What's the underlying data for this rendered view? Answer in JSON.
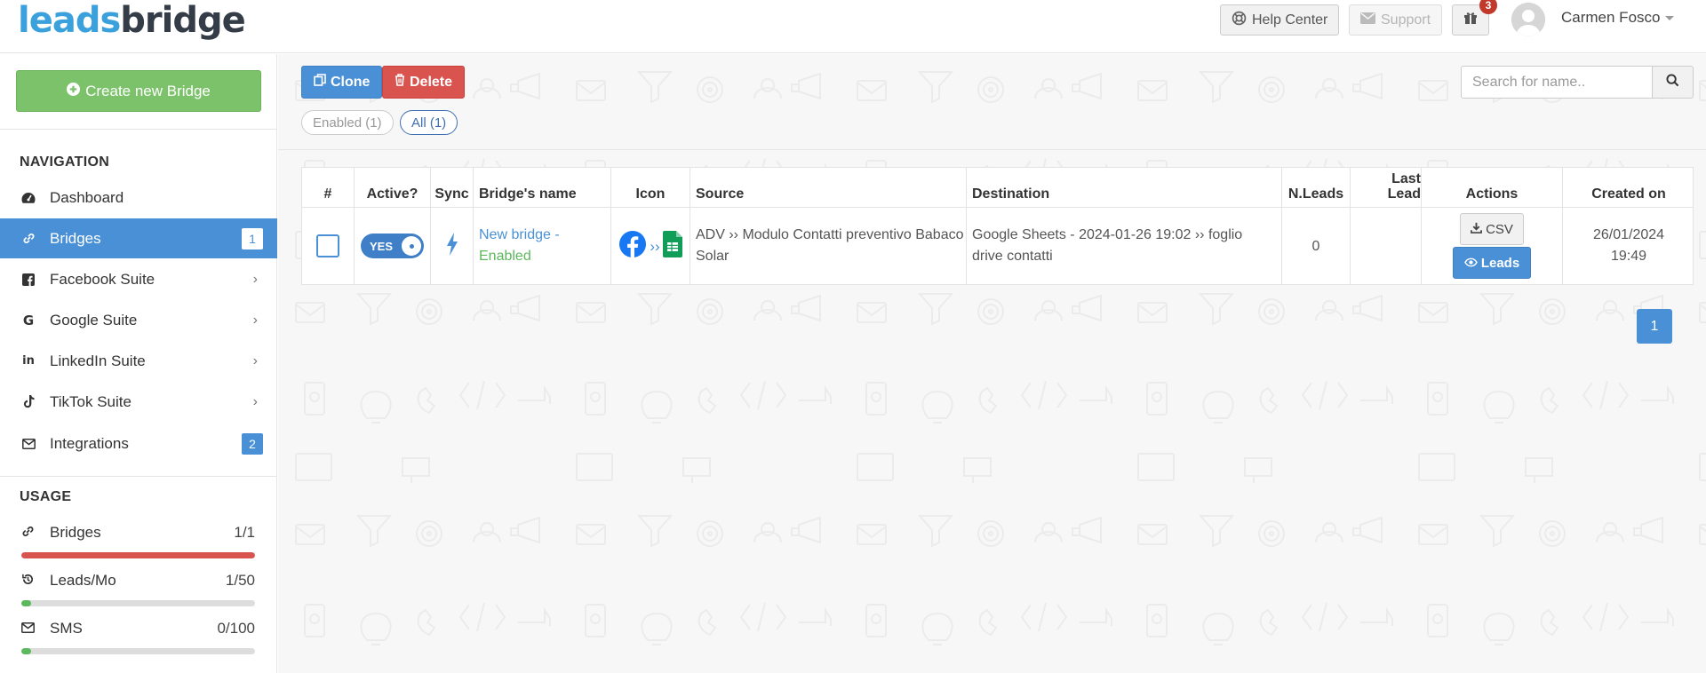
{
  "app": {
    "logo_part1": "leads",
    "logo_part2": "bridge"
  },
  "header": {
    "help_center": "Help Center",
    "support": "Support",
    "gift_count": "3",
    "user_name": "Carmen Fosco"
  },
  "sidebar": {
    "create_label": "Create new Bridge",
    "nav_title": "NAVIGATION",
    "items": [
      {
        "label": "Dashboard",
        "icon": "dashboard-icon"
      },
      {
        "label": "Bridges",
        "icon": "link-icon",
        "badge": "1",
        "active": true
      },
      {
        "label": "Facebook Suite",
        "icon": "facebook-icon"
      },
      {
        "label": "Google Suite",
        "icon": "google-icon"
      },
      {
        "label": "LinkedIn Suite",
        "icon": "linkedin-icon"
      },
      {
        "label": "TikTok Suite",
        "icon": "tiktok-icon"
      },
      {
        "label": "Integrations",
        "icon": "envelope-icon",
        "badge": "2"
      }
    ],
    "usage_title": "USAGE",
    "usage": [
      {
        "label": "Bridges",
        "value": "1/1",
        "fraction": 1.0,
        "color": "#d9534f"
      },
      {
        "label": "Leads/Mo",
        "value": "1/50",
        "fraction": 0.02,
        "color": "#5cb85c"
      },
      {
        "label": "SMS",
        "value": "0/100",
        "fraction": 0.0,
        "color": "#5cb85c"
      }
    ]
  },
  "toolbar": {
    "clone_label": "Clone",
    "delete_label": "Delete",
    "filter_enabled": "Enabled (1)",
    "filter_all": "All (1)",
    "search_placeholder": "Search for name.."
  },
  "table": {
    "headers": {
      "num": "#",
      "active": "Active?",
      "sync": "Sync",
      "name": "Bridge's name",
      "icon": "Icon",
      "source": "Source",
      "destination": "Destination",
      "nleads": "N.Leads",
      "last_lead_1": "Last",
      "last_lead_2": "Lead",
      "actions": "Actions",
      "created": "Created on"
    },
    "rows": [
      {
        "active_label": "YES",
        "name": "New bridge - ",
        "status": "Enabled",
        "source": "ADV ›› Modulo Contatti preventivo Babaco Solar",
        "destination": "Google Sheets - 2024-01-26 19:02 ›› foglio drive contatti",
        "nleads": "0",
        "last_lead": "",
        "csv_label": "CSV",
        "leads_label": "Leads",
        "created_date": "26/01/2024",
        "created_time": "19:49"
      }
    ]
  },
  "pagination": {
    "current": "1"
  }
}
